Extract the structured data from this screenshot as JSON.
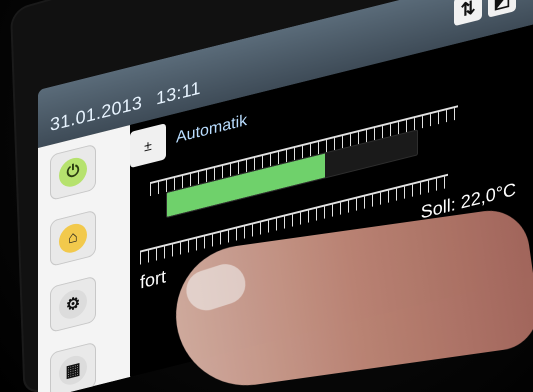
{
  "header": {
    "date": "31.01.2013",
    "time": "13:11",
    "mode_label": "Automatik"
  },
  "controls": {
    "top_right": {
      "up_down_icon": "up-down-icon",
      "logo_icon": "logo-icon"
    },
    "left_nav": {
      "power_icon": "power-icon",
      "home_icon": "home-icon",
      "settings_icon": "gear-icon",
      "grid_icon": "grid-icon"
    }
  },
  "thermostat": {
    "comfort_label": "fort",
    "setpoint_label": "Soll: 22,0°C",
    "fill_fraction": 0.63
  },
  "colors": {
    "topbar": "#3e4b57",
    "gauge_fill": "#6fd16b",
    "power_button": "#b6e26e",
    "home_button": "#f2c94c"
  }
}
